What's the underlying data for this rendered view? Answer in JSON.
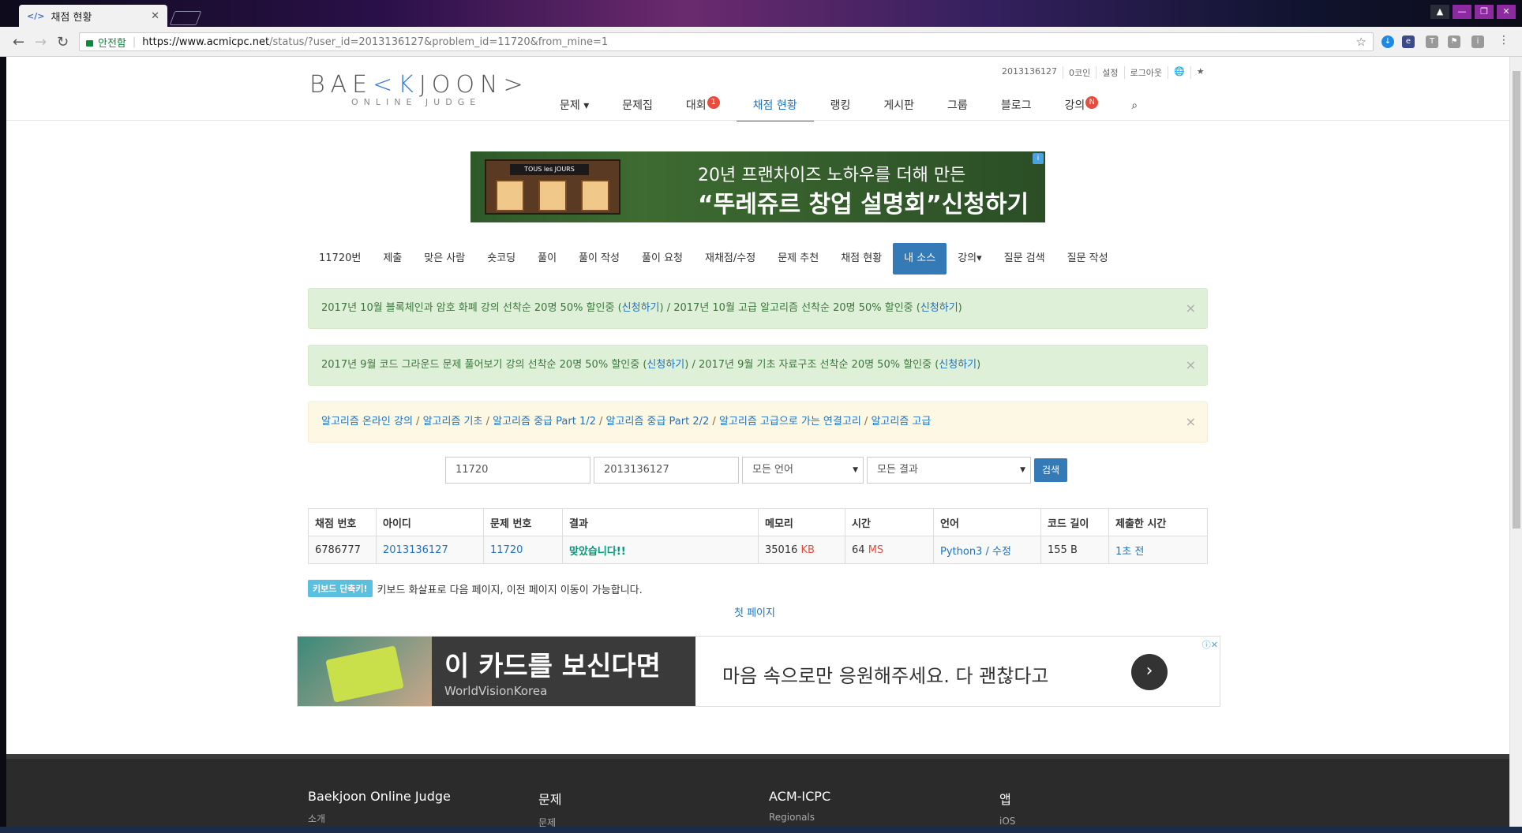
{
  "browser": {
    "tab_title": "채점 현황",
    "tab_icon": "</>",
    "secure_label": "안전함",
    "url_host": "https://www.acmicpc.net",
    "url_path": "/status/?user_id=2013136127&problem_id=11720&from_mine=1"
  },
  "header": {
    "top_links": [
      "2013136127",
      "0코인",
      "설정",
      "로그아웃",
      "🌐",
      "★"
    ],
    "logo_pre": "BAE",
    "logo_k": "<K",
    "logo_post": "JOON>",
    "logo_sub": "ONLINE JUDGE",
    "nav": [
      {
        "label": "문제 ▾"
      },
      {
        "label": "문제집"
      },
      {
        "label": "대회",
        "badge": "1"
      },
      {
        "label": "채점 현황",
        "active": true
      },
      {
        "label": "랭킹"
      },
      {
        "label": "게시판"
      },
      {
        "label": "그룹"
      },
      {
        "label": "블로그"
      },
      {
        "label": "강의",
        "badge": "N"
      }
    ]
  },
  "ad_top": {
    "line1": "20년 프랜차이즈 노하우를 더해 만든",
    "line2": "“뚜레쥬르 창업 설명회”신청하기",
    "store_sign": "TOUS les JOURS"
  },
  "subnav": [
    "11720번",
    "제출",
    "맞은 사람",
    "숏코딩",
    "풀이",
    "풀이 작성",
    "풀이 요청",
    "재채점/수정",
    "문제 추천",
    "채점 현황",
    "내 소스",
    "강의▾",
    "질문 검색",
    "질문 작성"
  ],
  "alerts": {
    "a1": {
      "pre": "2017년 10월 블록체인과 암호 화폐 강의 선착순 20명 50% 할인중 (",
      "link1": "신청하기",
      "mid": ") / 2017년 10월 고급 알고리즘 선착순 20명 50% 할인중 (",
      "link2": "신청하기",
      "post": ")"
    },
    "a2": {
      "pre": "2017년 9월 코드 그라운드 문제 풀어보기 강의 선착순 20명 50% 할인중 (",
      "link1": "신청하기",
      "mid": ") / 2017년 9월 기초 자료구조 선착순 20명 50% 할인중 (",
      "link2": "신청하기",
      "post": ")"
    },
    "a3": {
      "links": [
        "알고리즘 온라인 강의",
        "알고리즘 기초",
        "알고리즘 중급 Part 1/2",
        "알고리즘 중급 Part 2/2",
        "알고리즘 고급으로 가는 연결고리",
        "알고리즘 고급"
      ]
    },
    "close": "×"
  },
  "search": {
    "problem_id": "11720",
    "user_id": "2013136127",
    "language": "모든 언어",
    "result": "모든 결과",
    "button": "검색"
  },
  "table": {
    "headers": [
      "채점 번호",
      "아이디",
      "문제 번호",
      "결과",
      "메모리",
      "시간",
      "언어",
      "코드 길이",
      "제출한 시간"
    ],
    "row": {
      "id": "6786777",
      "user": "2013136127",
      "problem": "11720",
      "result": "맞았습니다!!",
      "memory": "35016",
      "memory_unit": "KB",
      "time": "64",
      "time_unit": "MS",
      "lang": "Python3",
      "lang_sep": " / ",
      "edit": "수정",
      "code_len": "155 B",
      "submitted": "1초 전"
    }
  },
  "shortcut": {
    "badge": "키보드 단축키!",
    "text": "키보드 화살표로 다음 페이지, 이전 페이지 이동이 가능합니다."
  },
  "first_page": "첫 페이지",
  "ad_bottom": {
    "headline": "이 카드를 보신다면",
    "brand": "WorldVisionKorea",
    "message": "마음 속으로만 응원해주세요. 다 괜찮다고",
    "go": "›",
    "info": "ⓘ✕"
  },
  "footer": {
    "cols": [
      {
        "title": "Baekjoon Online Judge",
        "sub": "소개"
      },
      {
        "title": "문제",
        "sub": "문제"
      },
      {
        "title": "ACM-ICPC",
        "sub": "Regionals"
      },
      {
        "title": "앱",
        "sub": "iOS"
      }
    ]
  },
  "colors": {
    "accent": "#337ab7",
    "success": "#009874",
    "alert_red": "#e74c3c"
  }
}
